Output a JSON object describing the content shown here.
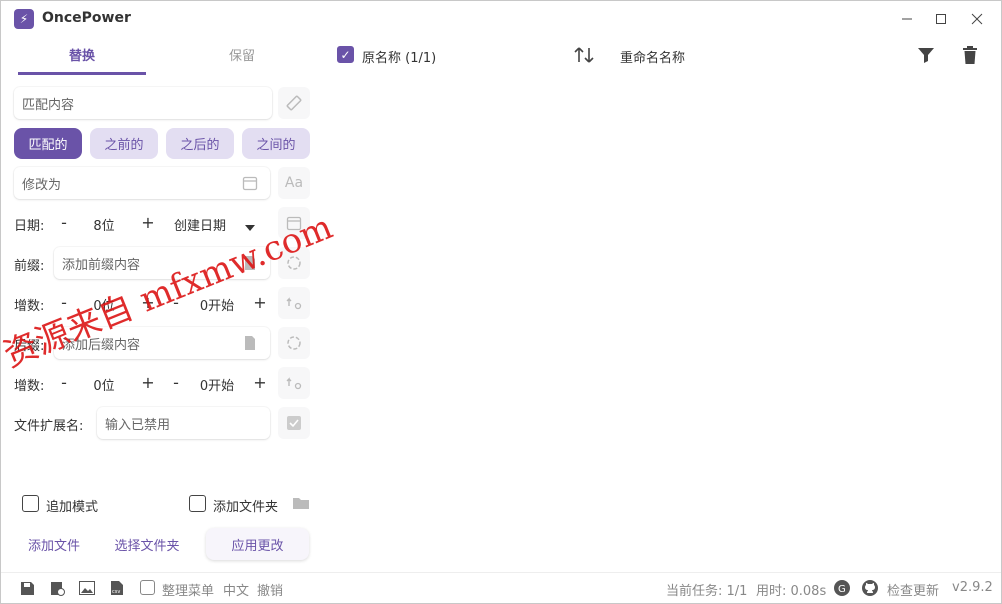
{
  "app": {
    "title": "OncePower"
  },
  "tabs": {
    "replace": "替换",
    "keep": "保留"
  },
  "match": {
    "placeholder": "匹配内容"
  },
  "modes": [
    "匹配的",
    "之前的",
    "之后的",
    "之间的"
  ],
  "modify": {
    "placeholder": "修改为"
  },
  "date": {
    "label": "日期:",
    "minus": "-",
    "value": "8位",
    "plus": "+",
    "type": "创建日期"
  },
  "prefix": {
    "label": "前缀:",
    "placeholder": "添加前缀内容"
  },
  "increment1": {
    "label": "增数:",
    "minus": "-",
    "value": "0位",
    "plus": "+",
    "minus2": "-",
    "start": "0开始",
    "plus2": "+"
  },
  "suffix": {
    "label": "后缀:",
    "placeholder": "添加后缀内容"
  },
  "increment2": {
    "label": "增数:",
    "minus": "-",
    "value": "0位",
    "plus": "+",
    "minus2": "-",
    "start": "0开始",
    "plus2": "+"
  },
  "extension": {
    "label": "文件扩展名:",
    "placeholder": "输入已禁用"
  },
  "options": {
    "append_mode": "追加模式",
    "add_folder": "添加文件夹"
  },
  "actions": {
    "add_file": "添加文件",
    "select_folder": "选择文件夹",
    "apply": "应用更改"
  },
  "list_header": {
    "original_name": "原名称 (1/1)",
    "rename_name": "重命名名称"
  },
  "statusbar": {
    "organize_menu": "整理菜单",
    "language": "中文",
    "undo": "撤销",
    "current_task": "当前任务: 1/1",
    "time_used": "用时: 0.08s",
    "check_update": "检查更新",
    "version": "v2.9.2"
  },
  "watermark": "资源来自 mfxmw.com",
  "colors": {
    "accent": "#6a53a8",
    "pill_bg": "#e3def2"
  }
}
